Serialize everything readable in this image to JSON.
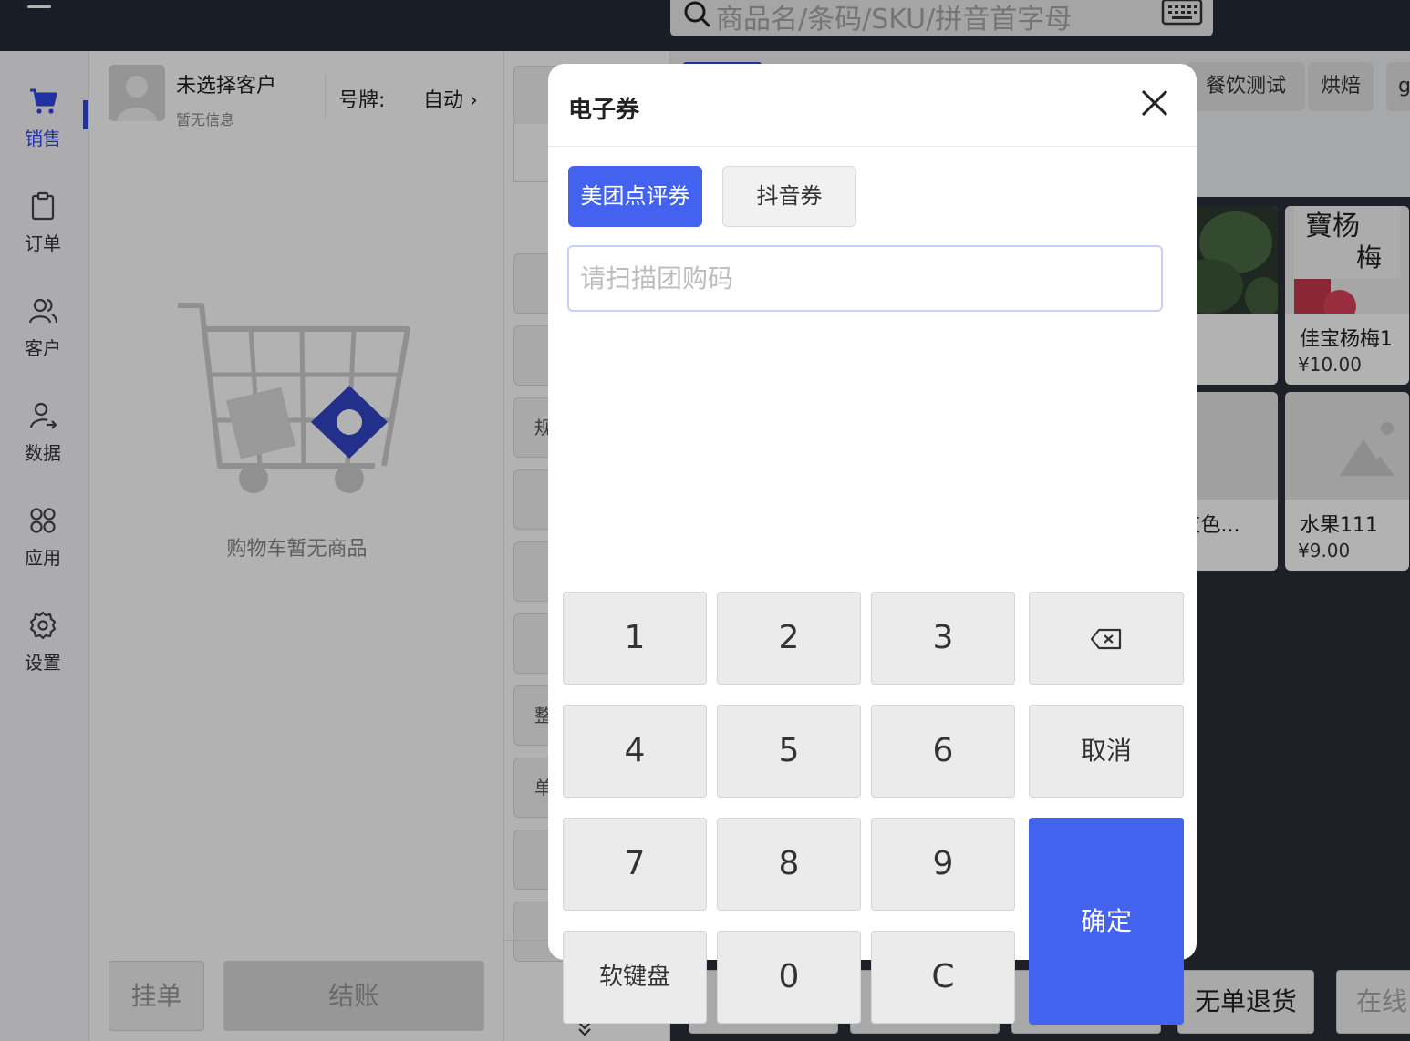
{
  "search": {
    "placeholder": "商品名/条码/SKU/拼音首字母"
  },
  "sidebar": {
    "items": [
      {
        "label": "销售",
        "icon": "cart-icon",
        "active": true
      },
      {
        "label": "订单",
        "icon": "clipboard-icon"
      },
      {
        "label": "客户",
        "icon": "users-icon"
      },
      {
        "label": "数据",
        "icon": "user-share-icon"
      },
      {
        "label": "应用",
        "icon": "apps-icon"
      },
      {
        "label": "设置",
        "icon": "gear-icon"
      }
    ]
  },
  "cart": {
    "customer_name": "未选择客户",
    "customer_sub": "暂无信息",
    "plate_label": "号牌:",
    "plate_value": "自动 ›",
    "empty_text": "购物车暂无商品",
    "hold_label": "挂单",
    "checkout_label": "结账"
  },
  "categories": {
    "visible_chars": [
      "规",
      "整",
      "单"
    ],
    "more_icon": "double-chevron-down-icon"
  },
  "products": {
    "chips": [
      "餐饮测试",
      "烘焙",
      "g"
    ],
    "cards": [
      {
        "name": "佳宝杨梅1",
        "price": "¥10.00"
      },
      {
        "name": "o灰色...",
        "price": ""
      },
      {
        "name": "水果111",
        "price": "¥9.00"
      }
    ],
    "bottom_buttons": [
      "无单退货",
      "在线"
    ]
  },
  "modal": {
    "title": "电子券",
    "tabs": [
      {
        "label": "美团点评券",
        "active": true
      },
      {
        "label": "抖音券",
        "active": false
      }
    ],
    "input_placeholder": "请扫描团购码",
    "input_value": "",
    "keys": {
      "k1": "1",
      "k2": "2",
      "k3": "3",
      "k4": "4",
      "k5": "5",
      "k6": "6",
      "k7": "7",
      "k8": "8",
      "k9": "9",
      "k0": "0",
      "clear": "C",
      "soft_keyboard": "软键盘",
      "cancel": "取消",
      "confirm": "确定"
    }
  },
  "colors": {
    "accent": "#4462f0",
    "nav_active": "#2e47e6",
    "topbar": "#252a35",
    "overlay": "rgba(0,0,0,0.30)"
  }
}
